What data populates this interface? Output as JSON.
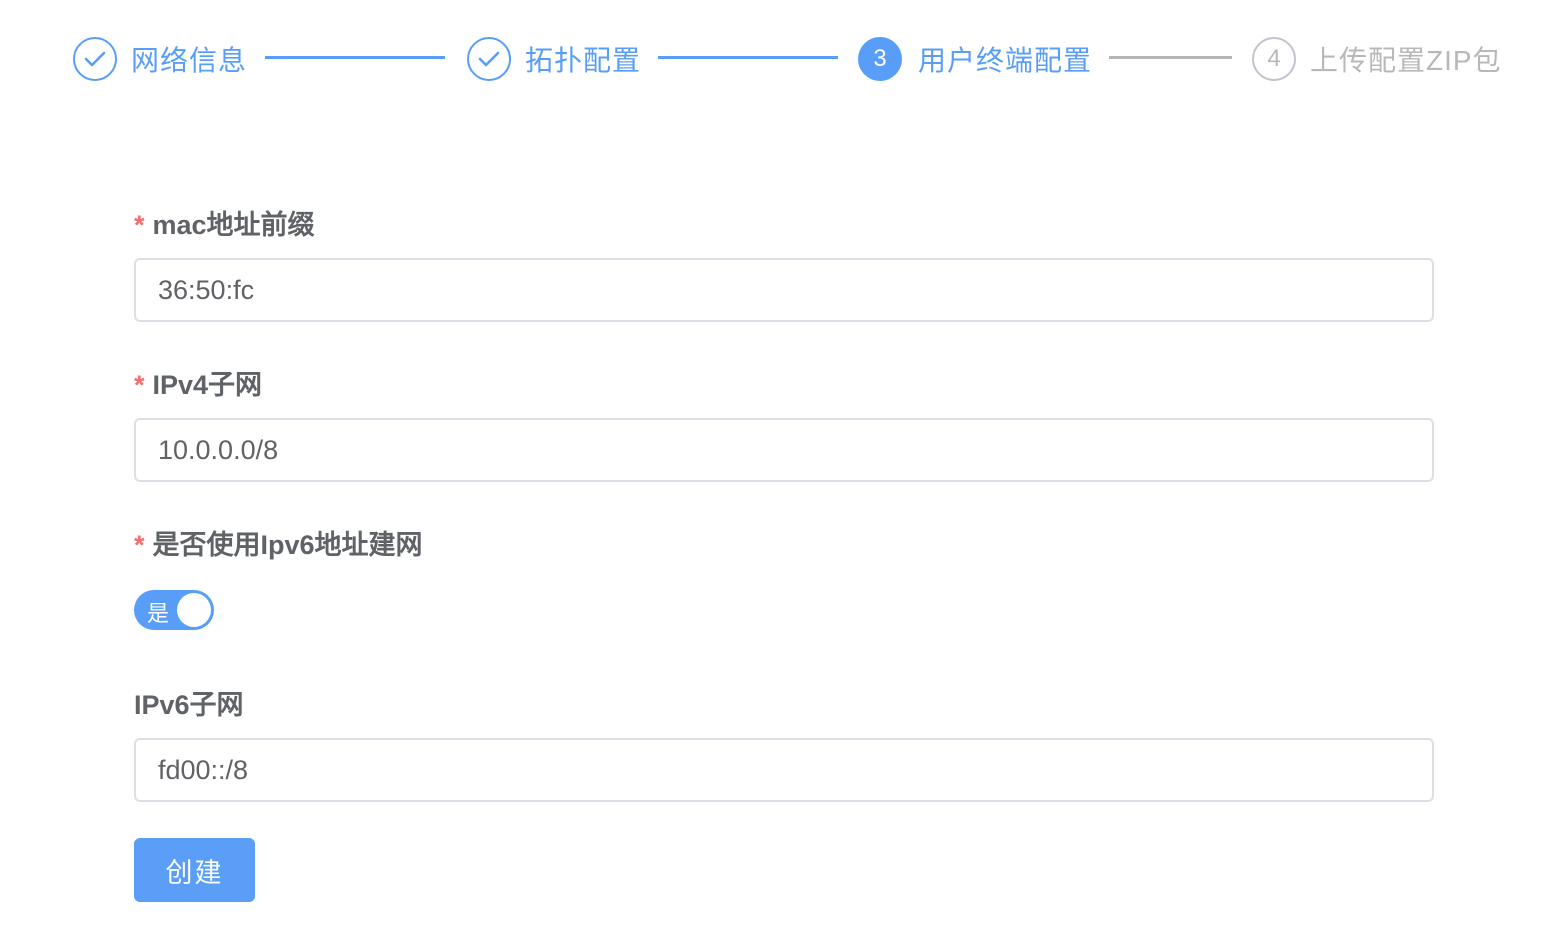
{
  "colors": {
    "primary": "#589ef8",
    "wait": "#b8b8b8",
    "required": "#f56c6c",
    "label": "#5f6266"
  },
  "steps": [
    {
      "number": "1",
      "title": "网络信息",
      "status": "done",
      "icon": "check-circle-icon"
    },
    {
      "number": "2",
      "title": "拓扑配置",
      "status": "done",
      "icon": "check-circle-icon"
    },
    {
      "number": "3",
      "title": "用户终端配置",
      "status": "active"
    },
    {
      "number": "4",
      "title": "上传配置ZIP包",
      "status": "wait"
    }
  ],
  "form": {
    "required_mark": "*",
    "mac_prefix": {
      "label": "mac地址前缀",
      "value": "36:50:fc"
    },
    "ipv4_subnet": {
      "label": "IPv4子网",
      "value": "10.0.0.0/8"
    },
    "use_ipv6": {
      "label": "是否使用Ipv6地址建网",
      "switch_text": "是",
      "enabled": true
    },
    "ipv6_subnet": {
      "label": "IPv6子网",
      "value": "fd00::/8"
    },
    "submit_label": "创建"
  }
}
